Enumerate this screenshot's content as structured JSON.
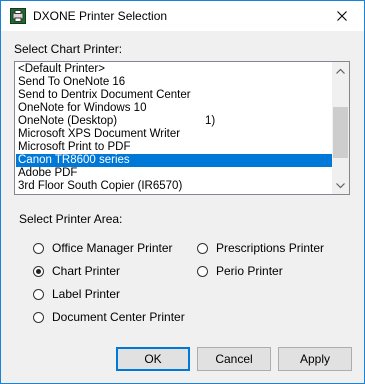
{
  "window": {
    "title": "DXONE Printer Selection",
    "accent_color": "#0078d7",
    "app_icon": "dxone-printer-icon",
    "close_icon": "close-icon"
  },
  "chart_printer": {
    "label": "Select Chart Printer:",
    "items": [
      "<Default Printer>",
      "Send To OneNote 16",
      "Send to Dentrix Document Center",
      "OneNote for Windows 10",
      "OneNote (Desktop)",
      "Microsoft XPS Document Writer",
      "Microsoft Print to PDF",
      "Canon TR8600 series",
      "Adobe PDF",
      "3rd Floor South Copier (IR6570)"
    ],
    "partial_text": "1)",
    "selected": "Canon TR8600 series"
  },
  "printer_area": {
    "label": "Select Printer Area:",
    "options": [
      "Office Manager Printer",
      "Chart Printer",
      "Label Printer",
      "Document Center Printer",
      "Prescriptions Printer",
      "Perio Printer"
    ],
    "selected": "Chart Printer"
  },
  "buttons": {
    "ok": "OK",
    "cancel": "Cancel",
    "apply": "Apply"
  }
}
